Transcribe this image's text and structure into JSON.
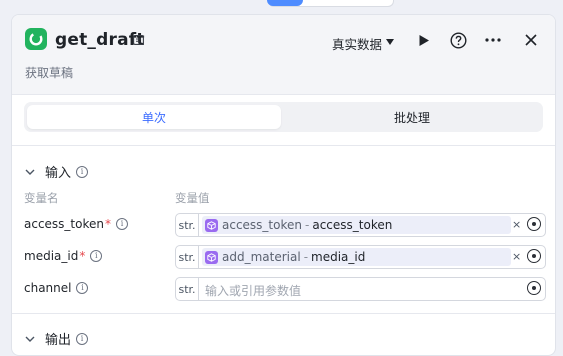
{
  "node": {
    "title": "get_draft",
    "subtitle": "获取草稿",
    "data_mode": "真实数据",
    "icons": [
      "node-logo-icon",
      "doc-icon",
      "play-icon",
      "help-icon",
      "more-icon",
      "close-icon"
    ]
  },
  "tabs": {
    "single": "单次",
    "batch": "批处理",
    "active": "single"
  },
  "input_section": {
    "title": "输入",
    "col_name": "变量名",
    "col_value": "变量值",
    "rows": [
      {
        "name": "access_token",
        "required": "*",
        "type": "str.",
        "source": "access_token",
        "separator": "-",
        "variable": "access_token",
        "clear": "×"
      },
      {
        "name": "media_id",
        "required": "*",
        "type": "str.",
        "source": "add_material",
        "separator": "-",
        "variable": "media_id",
        "clear": "×"
      },
      {
        "name": "channel",
        "required": "",
        "type": "str.",
        "placeholder": "输入或引用参数值"
      }
    ]
  },
  "output_section": {
    "title": "输出"
  },
  "colors": {
    "accent": "#3b6cff",
    "logo": "#22b35e",
    "tag_icon": "#9a6bf0",
    "required": "#e5484d"
  }
}
